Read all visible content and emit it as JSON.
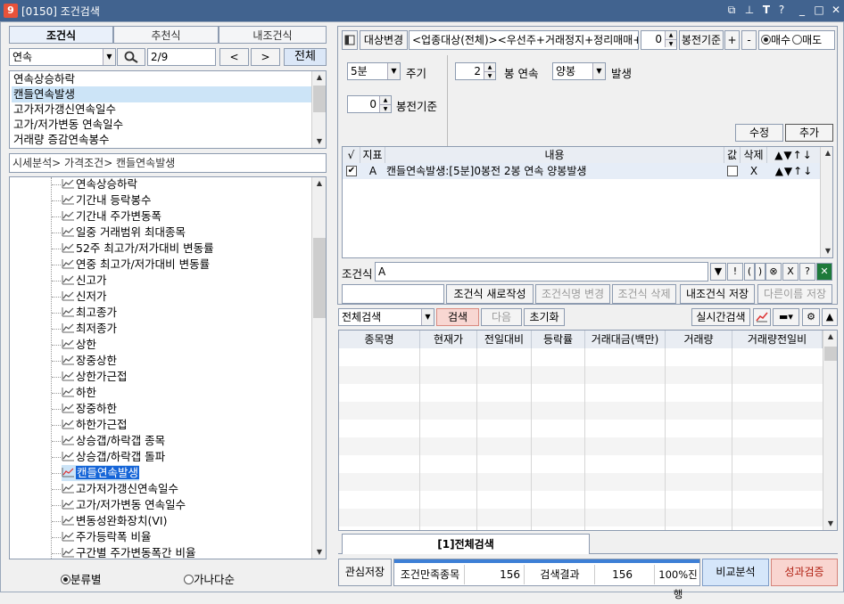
{
  "window": {
    "icon_label": "9",
    "title": "[0150] 조건검색",
    "buttons": [
      "⧉",
      "⊥",
      "T",
      "?",
      "_",
      "□",
      "✕"
    ]
  },
  "left": {
    "tabs": [
      "조건식",
      "추천식",
      "내조건식"
    ],
    "search": {
      "value": "연속",
      "page": "2/9",
      "prev": "<",
      "next": ">",
      "all": "전체"
    },
    "results": [
      "연속상승하락",
      "캔들연속발생",
      "고가저가갱신연속일수",
      "고가/저가변동 연속일수",
      "거래량 증감연속봉수"
    ],
    "path": "시세분석> 가격조건> 캔들연속발생",
    "tree": [
      "연속상승하락",
      "기간내 등락봉수",
      "기간내 주가변동폭",
      "일중 거래범위 최대종목",
      "52주 최고가/저가대비 변동률",
      "연중 최고가/저가대비 변동률",
      "신고가",
      "신저가",
      "최고종가",
      "최저종가",
      "상한",
      "장중상한",
      "상한가근접",
      "하한",
      "장중하한",
      "하한가근접",
      "상승갭/하락갭 종목",
      "상승갭/하락갭 돌파",
      "캔들연속발생",
      "고가저가갱신연속일수",
      "고가/저가변동 연속일수",
      "변동성완화장치(VI)",
      "주가등락폭 비율",
      "구간별 주가변동폭간 비율"
    ],
    "sort_options": [
      "분류별",
      "가나다순"
    ]
  },
  "right": {
    "top": {
      "target_button": "대상변경",
      "target_text": "<업종대상(전체)><우선주+거래정지+정리매매+ETF+ETN+스팩+관리종목+투자경고+투자위험+불성실공시>",
      "spin_value": "0",
      "criteria_label": "봉전기준",
      "plus": "+",
      "minus": "-",
      "buy": "매수",
      "sell": "매도"
    },
    "params": {
      "period_value": "5분",
      "period_label": "주기",
      "count_value": "2",
      "count_label": "봉 연속",
      "candle_value": "양봉",
      "occur_label": "발생",
      "prev_value": "0",
      "prev_label": "봉전기준"
    },
    "edit_btn": "수정",
    "add_btn": "추가",
    "cond_table": {
      "headers": [
        "√",
        "지표",
        "내용",
        "값",
        "삭제",
        "▲▼↑↓"
      ],
      "rows": [
        {
          "key": "A",
          "content": "캔들연속발생:[5분]0봉전 2봉 연속 양봉발생",
          "del": "X",
          "moves": "▲▼↑↓"
        }
      ]
    },
    "formula": {
      "label": "조건식",
      "value": "A",
      "ops": [
        "▼",
        "!",
        "(",
        ")",
        "⊗",
        "X",
        "?"
      ]
    },
    "actions": {
      "name_value": "",
      "new_btn": "조건식 새로작성",
      "rename_btn": "조건식명 변경",
      "delete_btn": "조건식 삭제",
      "save_btn": "내조건식 저장",
      "saveas_btn": "다른이름 저장"
    },
    "search_bar": {
      "mode": "전체검색",
      "search_btn": "검색",
      "next_btn": "다음",
      "reset_btn": "초기화",
      "realtime_btn": "실시간검색"
    },
    "grid": {
      "headers": [
        "종목명",
        "현재가",
        "전일대비",
        "등락률",
        "거래대금(백만)",
        "거래량",
        "거래량전일비"
      ]
    },
    "result_tab": "[1]전체검색",
    "status": {
      "interest_btn": "관심저장",
      "match_label": "조건만족종목",
      "match_value": "156",
      "result_label": "검색결과",
      "result_value": "156",
      "progress_label": "100%진행",
      "progress_fraction": 1.0,
      "compare_btn": "비교분석",
      "perf_btn": "성과검증"
    }
  }
}
